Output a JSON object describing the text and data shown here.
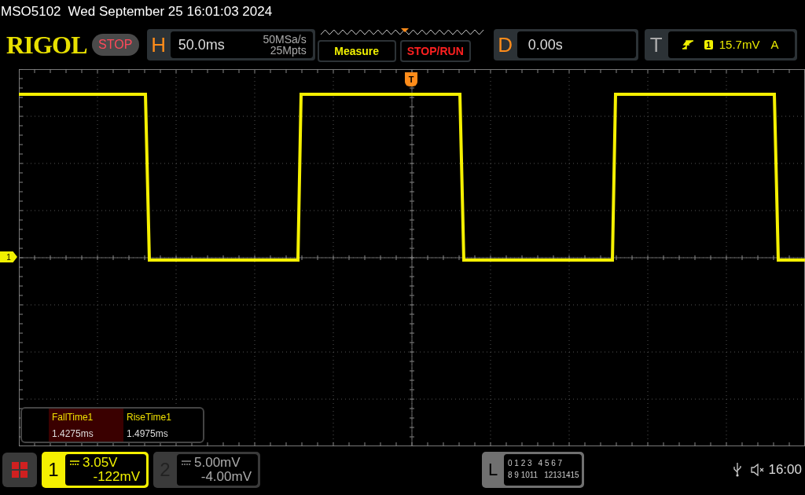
{
  "title_bar": {
    "model": "MSO5102",
    "datetime": "Wed September 25 16:01:03 2024"
  },
  "header": {
    "logo": "RIGOL",
    "run_state": "STOP",
    "horizontal": {
      "label": "H",
      "timebase": "50.0ms",
      "sample_rate": "50MSa/s",
      "memory_depth": "25Mpts"
    },
    "buttons": [
      {
        "label": "Measure",
        "kind": "measure"
      },
      {
        "label": "STOP/RUN",
        "kind": "run"
      }
    ],
    "delay": {
      "label": "D",
      "value": "0.00s"
    },
    "trigger": {
      "label": "T",
      "source": "1",
      "level": "15.7mV",
      "mode": "A"
    }
  },
  "display": {
    "trigger_marker": "T",
    "channel_marker": "1",
    "measurements": [
      {
        "name": "FallTime1",
        "value": "1.4275ms",
        "selected": true
      },
      {
        "name": "RiseTime1",
        "value": "1.4975ms",
        "selected": false
      }
    ]
  },
  "channels": [
    {
      "number": "1",
      "scale": "3.05V",
      "offset": "-122mV",
      "active": true
    },
    {
      "number": "2",
      "scale": "5.00mV",
      "offset": "-4.00mV",
      "active": false
    }
  ],
  "logic": {
    "label": "L",
    "rows": [
      [
        "0 1 2 3",
        "4 5 6 7"
      ],
      [
        "8 9 1011",
        "12131415"
      ]
    ]
  },
  "status": {
    "time": "16:00"
  }
}
